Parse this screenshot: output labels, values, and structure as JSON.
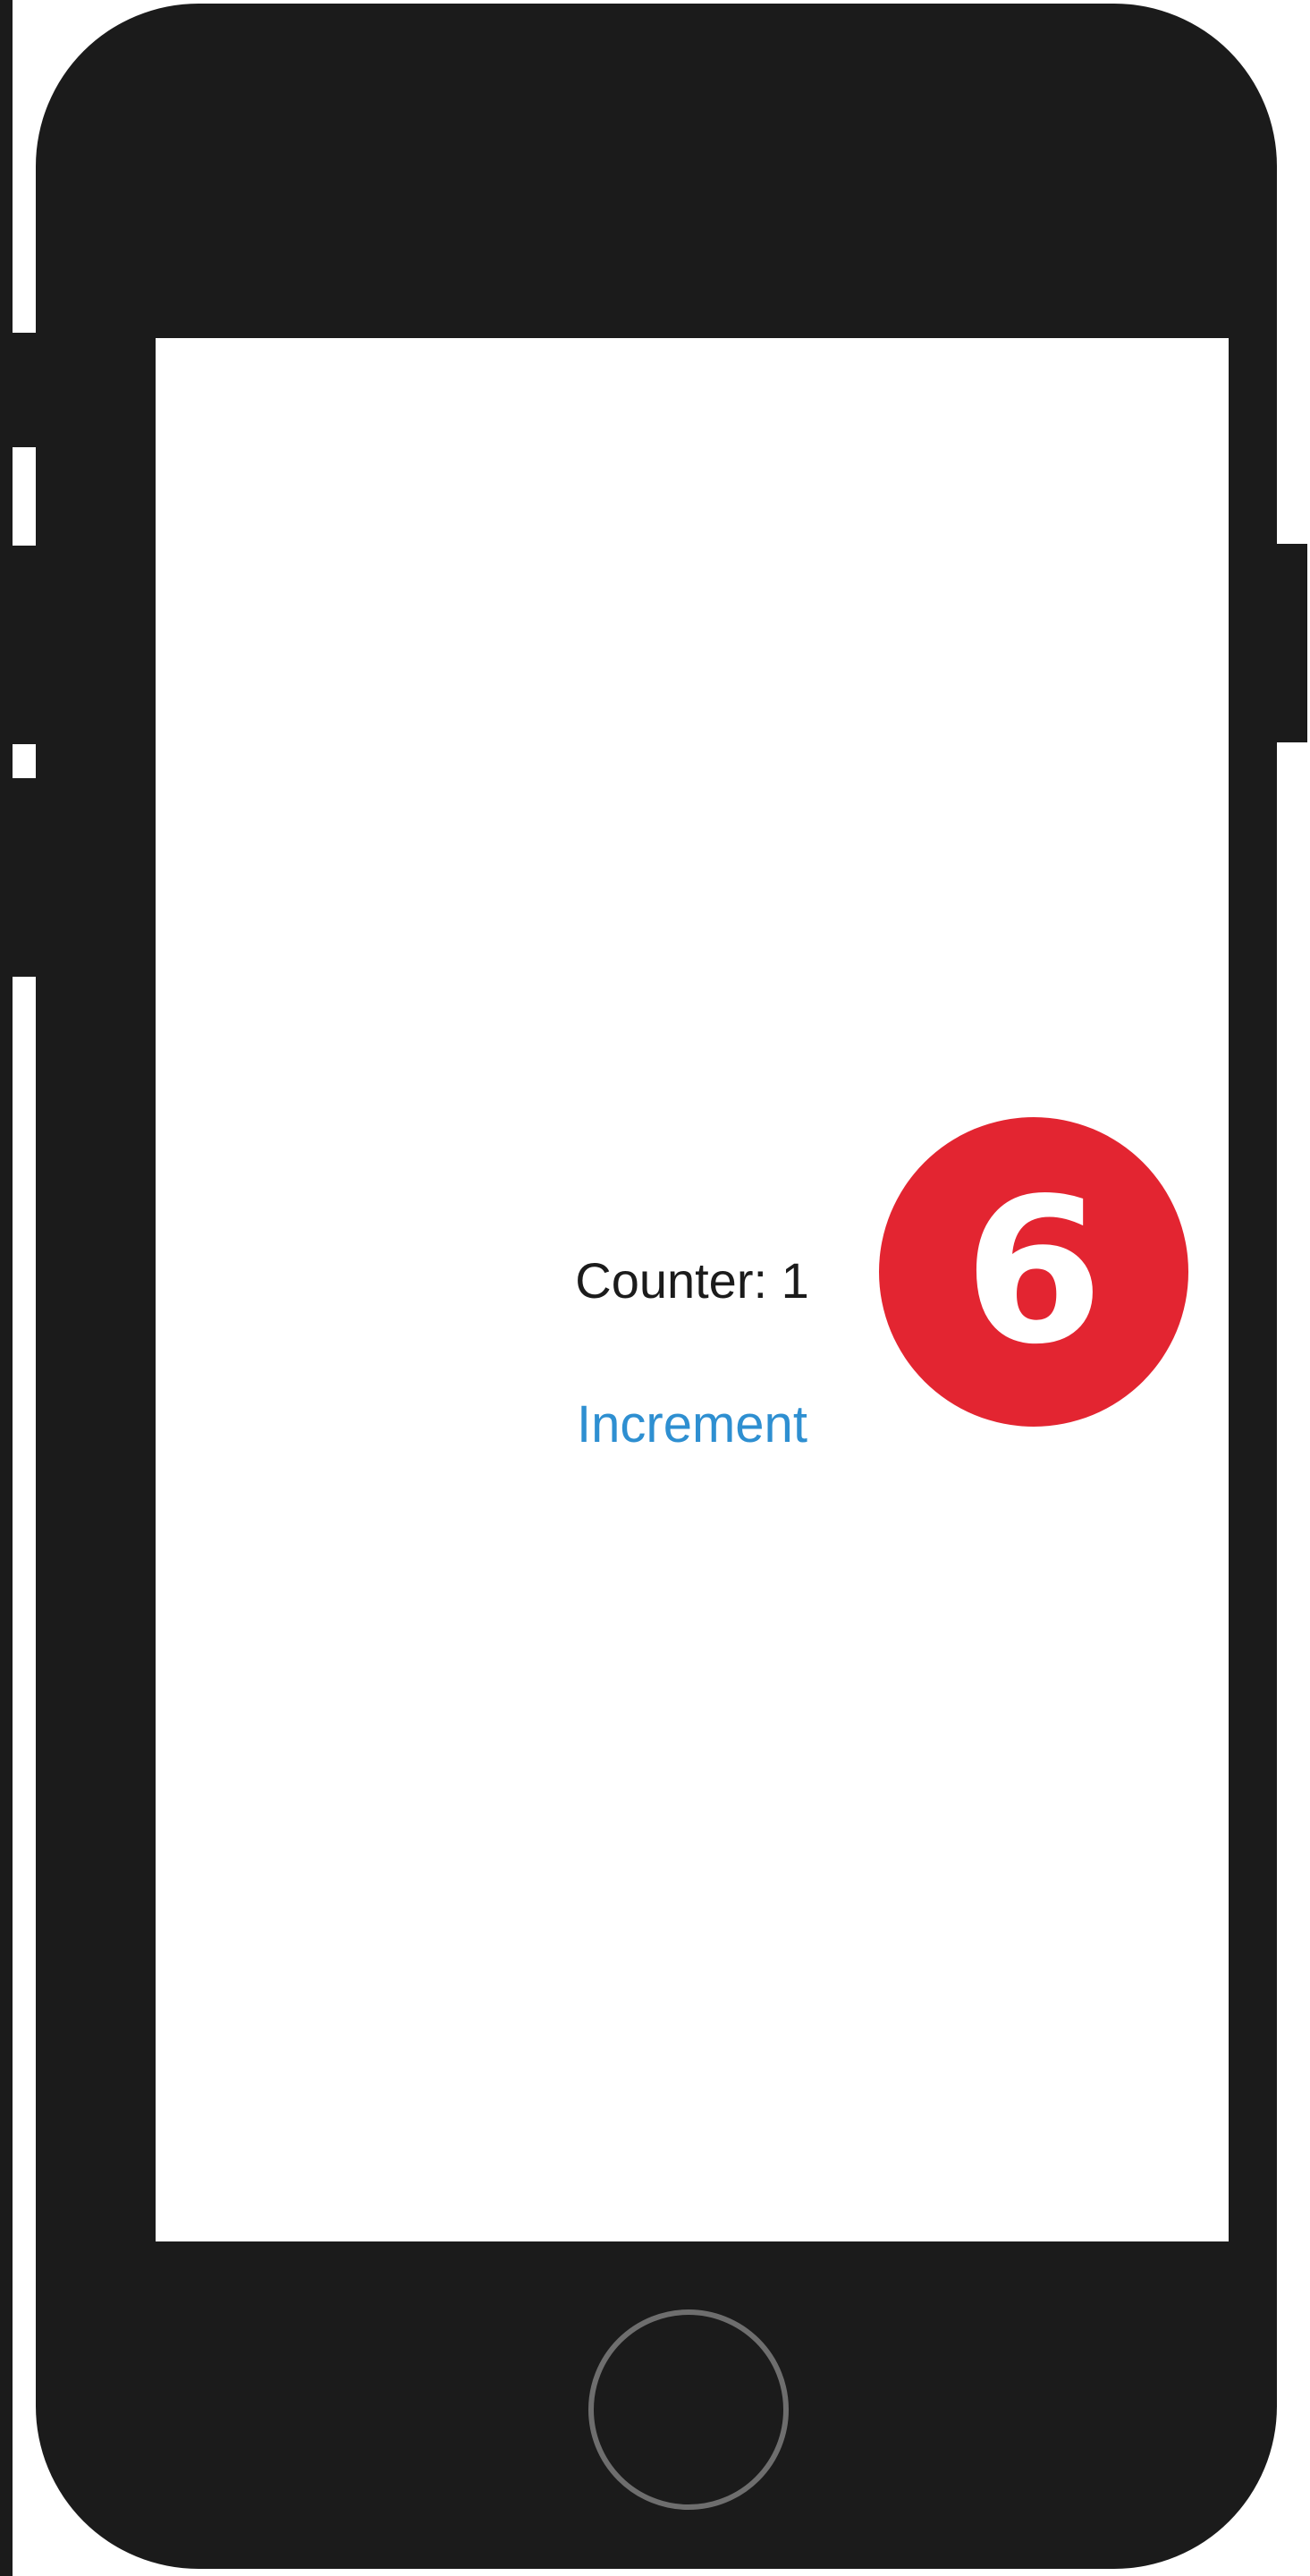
{
  "screen": {
    "counter_label": "Counter: 1",
    "increment_label": "Increment"
  },
  "step_badge": {
    "number": "6"
  },
  "colors": {
    "phone_body": "#1b1b1b",
    "screen_background": "#ffffff",
    "counter_text": "#1b1b1b",
    "button_text": "#2e8fd1",
    "badge_background": "#e32531",
    "badge_text": "#ffffff",
    "home_button_ring": "#6e6e6e"
  }
}
